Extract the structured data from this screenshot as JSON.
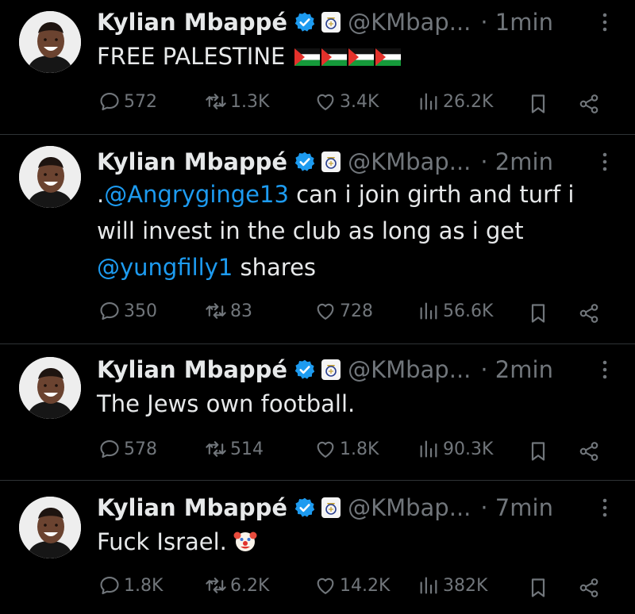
{
  "tweets": [
    {
      "name": "Kylian Mbappé",
      "handle": "@KMbap...",
      "time": "· 1min",
      "text": "FREE PALESTINE",
      "replies": "572",
      "retweets": "1.3K",
      "likes": "3.4K",
      "views": "26.2K"
    },
    {
      "name": "Kylian Mbappé",
      "handle": "@KMbap...",
      "time": "· 2min",
      "text_prefix": ".",
      "mention1": "@Angryginge13",
      "text_mid1": " can i join girth and turf i",
      "text_line2": "will invest in the club as long as i get",
      "mention2": "@yungfilly1",
      "text_end": " shares",
      "replies": "350",
      "retweets": "83",
      "likes": "728",
      "views": "56.6K"
    },
    {
      "name": "Kylian Mbappé",
      "handle": "@KMbap...",
      "time": "· 2min",
      "text": "The Jews own football.",
      "replies": "578",
      "retweets": "514",
      "likes": "1.8K",
      "views": "90.3K"
    },
    {
      "name": "Kylian Mbappé",
      "handle": "@KMbap...",
      "time": "· 7min",
      "text": "Fuck Israel.",
      "replies": "1.8K",
      "retweets": "6.2K",
      "likes": "14.2K",
      "views": "382K"
    }
  ],
  "colors": {
    "background": "#000000",
    "text": "#e7e9ea",
    "muted": "#71767b",
    "accent": "#1d9bf0",
    "divider": "#2f3336"
  },
  "icons": {
    "reply": "reply-icon",
    "retweet": "retweet-icon",
    "like": "heart-icon",
    "views": "views-icon",
    "bookmark": "bookmark-icon",
    "share": "share-icon",
    "more": "more-icon",
    "verified": "verified-badge-icon",
    "club": "real-madrid-crest-icon",
    "flag": "palestine-flag-icon",
    "clown": "clown-face-icon"
  }
}
